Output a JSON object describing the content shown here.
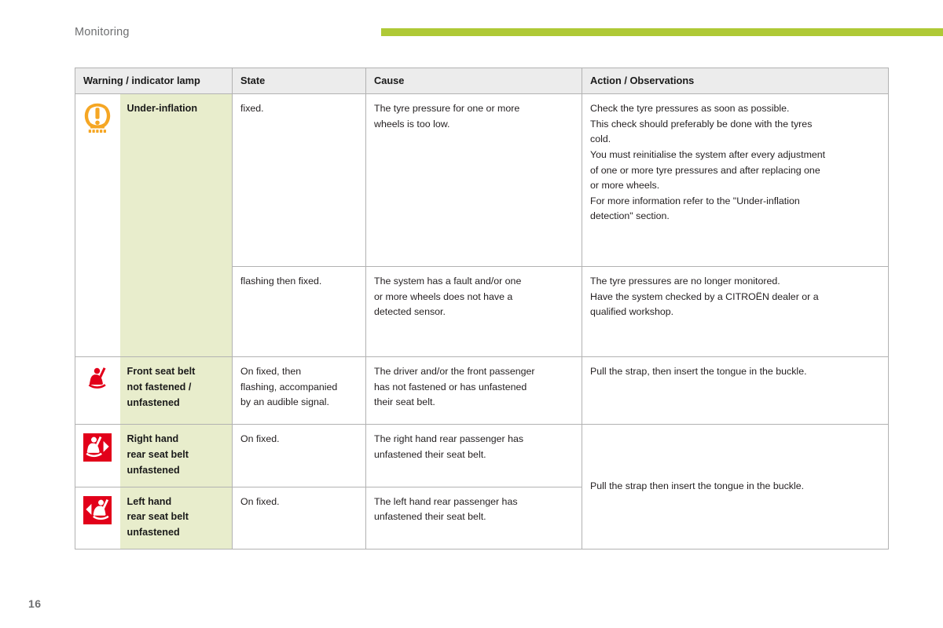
{
  "header": {
    "section_title": "Monitoring",
    "rule_color": "#afc936"
  },
  "colors": {
    "accent_green": "#afc936",
    "label_cell_bg": "#e8edcc",
    "table_header_bg": "#ececec",
    "amber_icon": "#f5a623",
    "red_icon": "#e2001a"
  },
  "table": {
    "columns": [
      {
        "key": "lamp",
        "label": "Warning / indicator lamp"
      },
      {
        "key": "state",
        "label": "State"
      },
      {
        "key": "cause",
        "label": "Cause"
      },
      {
        "key": "action",
        "label": "Action / Observations"
      }
    ],
    "rows": [
      {
        "icon": "tyre-under-inflation-icon",
        "label": "Under-inflation",
        "state": "fixed.",
        "cause": "The tyre pressure for one or more\nwheels is too low.",
        "action": "Check the tyre pressures as soon as possible.\nThis check should preferably be done with the tyres\ncold.\nYou must reinitialise the system after every adjustment\nof one or more tyre pressures and after replacing one\nor more wheels.\nFor more information refer to the \"Under-inflation\ndetection\" section."
      },
      {
        "icon": null,
        "label": null,
        "state": "flashing then fixed.",
        "cause": "The system has a fault and/or one\nor more wheels does not have a\ndetected sensor.",
        "action": "The tyre pressures are no longer monitored.\nHave the system checked by a CITROËN dealer or a\nqualified workshop."
      },
      {
        "icon": "front-seat-belt-icon",
        "label": "Front seat belt\nnot fastened /\nunfastened",
        "state": "On fixed, then\nflashing, accompanied\nby an audible signal.",
        "cause": "The driver and/or the front passenger\nhas not fastened or has unfastened\ntheir seat belt.",
        "action": "Pull the strap, then insert the tongue in the buckle."
      },
      {
        "icon": "right-hand-rear-seat-belt-icon",
        "label": "Right hand\nrear seat belt\nunfastened",
        "state": "On fixed.",
        "cause": "The right hand rear passenger has\nunfastened their seat belt.",
        "action": "Pull the strap then insert the tongue in the buckle."
      },
      {
        "icon": "left-hand-rear-seat-belt-icon",
        "label": "Left hand\nrear seat belt\nunfastened",
        "state": "On fixed.",
        "cause": "The left hand rear passenger has\nunfastened their seat belt.",
        "action": null
      }
    ]
  },
  "footer": {
    "page_number": "16"
  }
}
